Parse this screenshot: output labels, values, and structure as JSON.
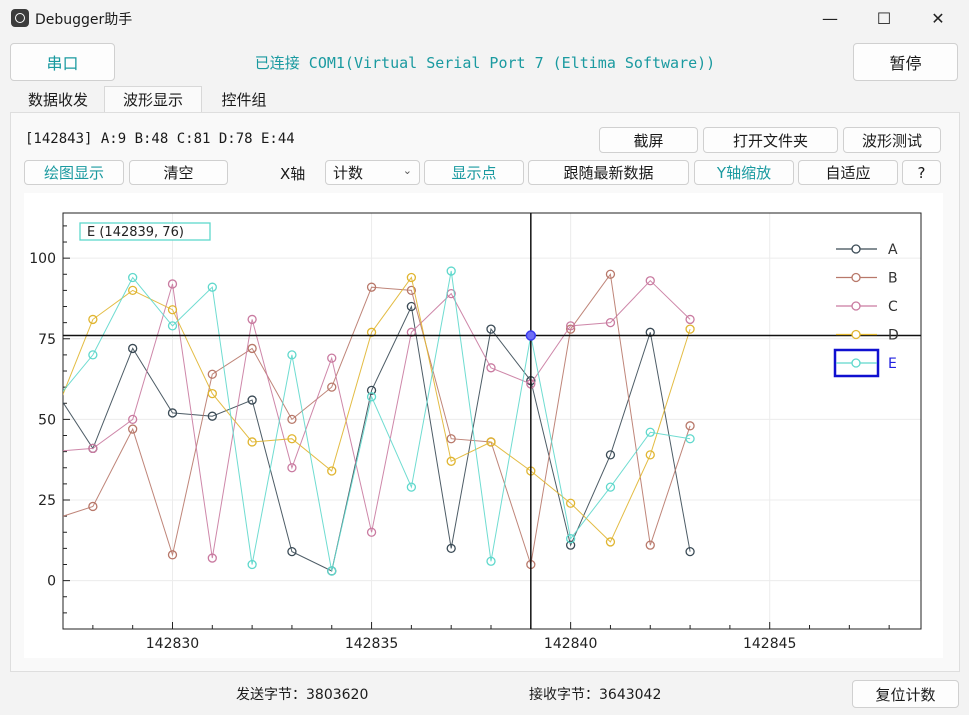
{
  "window": {
    "title": "Debugger助手",
    "minimize": "—",
    "maximize": "☐",
    "close": "✕"
  },
  "top": {
    "serial_button": "串口",
    "status": "已连接 COM1(Virtual Serial Port 7 (Eltima Software))",
    "pause_button": "暂停"
  },
  "tabs": [
    {
      "label": "数据收发",
      "active": false
    },
    {
      "label": "波形显示",
      "active": true
    },
    {
      "label": "控件组",
      "active": false
    }
  ],
  "data_line": "[142843] A:9 B:48 C:81 D:78 E:44",
  "toolbar1": {
    "screenshot": "截屏",
    "open_folder": "打开文件夹",
    "wave_test": "波形测试"
  },
  "toolbar2": {
    "plot_display": "绘图显示",
    "clear": "清空",
    "x_axis_label": "X轴",
    "x_axis_value": "计数",
    "show_points": "显示点",
    "follow_latest": "跟随最新数据",
    "y_zoom": "Y轴缩放",
    "auto_fit": "自适应",
    "help": "?"
  },
  "footer": {
    "sent_label": "发送字节：",
    "sent_value": "3803620",
    "recv_label": "接收字节：",
    "recv_value": "3643042",
    "reset_button": "复位计数"
  },
  "colors": {
    "accent": "#1a9aa0",
    "A": "#3a4a55",
    "B": "#b8786a",
    "C": "#c97aa0",
    "D": "#e0b530",
    "E": "#5fd8cc",
    "cursor": "#3b3bf0"
  },
  "chart_data": {
    "type": "line",
    "x": [
      142827,
      142828,
      142829,
      142830,
      142831,
      142832,
      142833,
      142834,
      142835,
      142836,
      142837,
      142838,
      142839,
      142840,
      142841,
      142842,
      142843
    ],
    "series": [
      {
        "name": "A",
        "values": [
          60,
          41,
          72,
          52,
          51,
          56,
          9,
          3,
          59,
          85,
          10,
          78,
          62,
          11,
          39,
          77,
          9
        ]
      },
      {
        "name": "B",
        "values": [
          19,
          23,
          47,
          8,
          64,
          72,
          50,
          60,
          91,
          90,
          44,
          43,
          5,
          78,
          95,
          11,
          48
        ]
      },
      {
        "name": "C",
        "values": [
          40,
          41,
          50,
          92,
          7,
          81,
          35,
          69,
          15,
          77,
          89,
          66,
          61,
          79,
          80,
          93,
          81
        ]
      },
      {
        "name": "D",
        "values": [
          50,
          81,
          90,
          84,
          58,
          43,
          44,
          34,
          77,
          94,
          37,
          43,
          34,
          24,
          12,
          39,
          78
        ]
      },
      {
        "name": "E",
        "values": [
          55,
          70,
          94,
          79,
          91,
          5,
          70,
          3,
          57,
          29,
          96,
          6,
          76,
          13,
          29,
          46,
          44
        ]
      }
    ],
    "x_ticks": [
      142830,
      142835,
      142840,
      142845
    ],
    "y_ticks": [
      0,
      25,
      50,
      75,
      100
    ],
    "xlim": [
      142827.25,
      142848.8
    ],
    "ylim": [
      -15,
      114
    ],
    "cursor": {
      "x": 142839,
      "y": 76,
      "label": "E (142839, 76)"
    },
    "selected_series": "E",
    "legend": "top-right",
    "grid": true
  }
}
